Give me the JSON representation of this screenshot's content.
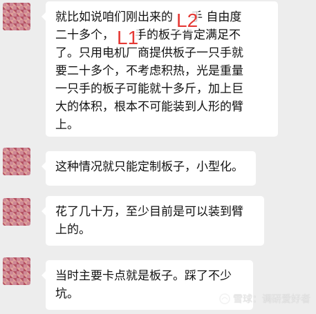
{
  "chat": {
    "messages": [
      {
        "lines": [
          "就比如说咱们刚出来的",
          "二十多个，",
          "了。只用电机厂商提供板子一只手就",
          "要二十多个，不考虑积热，光是重量",
          "一只手的板子可能就十多斤，加上巨",
          "大的体积，根本不可能装到人形的臂",
          "上。"
        ],
        "line1_tail": "手 自由度",
        "line2_tail": "手的板子肯定满足不"
      },
      {
        "lines": [
          "这种情况就只能定制板子，小型化。"
        ]
      },
      {
        "lines": [
          "花了几十万，至少目前是可以装到臂",
          "上的。"
        ]
      },
      {
        "lines": [
          "当时主要卡点就是板子。踩了不少",
          "坑。"
        ]
      }
    ]
  },
  "annotations": {
    "label_l2": "L2",
    "label_l1": "L1"
  },
  "watermark": {
    "text": "雪球：调研爱好者"
  },
  "colors": {
    "background": "#ededed",
    "bubble": "#ffffff",
    "text": "#111111",
    "annotation": "#e53935"
  }
}
